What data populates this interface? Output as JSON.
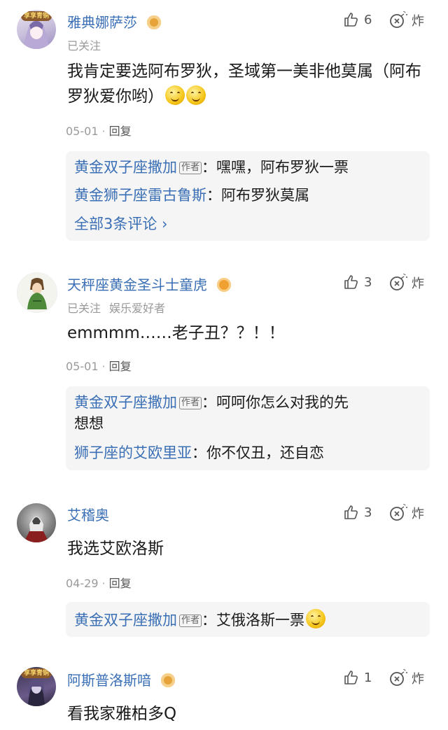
{
  "colors": {
    "link_blue": "#3a6fb5",
    "meta_gray": "#9a9a9a",
    "reply_bg": "#f5f5f5",
    "badge_orange": "#f0a030"
  },
  "icons": {
    "like": "thumbs-up-icon",
    "bomb": "bomb-icon",
    "level": "level-badge-icon",
    "chevron": "chevron-right-icon"
  },
  "comments": [
    {
      "username": "雅典娜萨莎",
      "avatar_badge": "享享青铜",
      "follow_status": "已关注",
      "tag": "",
      "likes": "6",
      "bomb_label": "炸",
      "text": "我肯定要选阿布罗狄，圣域第一美非他莫属（阿布罗狄爱你哟）",
      "date": "05-01",
      "reply_label": "回复",
      "replies": [
        {
          "name": "黄金双子座撒加",
          "author_tag": "作者",
          "text": "：嘿嘿，阿布罗狄一票"
        },
        {
          "name": "黄金狮子座雷古鲁斯",
          "author_tag": "",
          "text": "：阿布罗狄莫属"
        }
      ],
      "expand_label": "全部3条评论 ›"
    },
    {
      "username": "天秤座黄金圣斗士童虎",
      "avatar_badge": "",
      "follow_status": "已关注",
      "tag": "娱乐爱好者",
      "likes": "3",
      "bomb_label": "炸",
      "text": "emmmm……老子丑？？！！",
      "date": "05-01",
      "reply_label": "回复",
      "replies": [
        {
          "name": "黄金双子座撒加",
          "author_tag": "作者",
          "text": "：呵呵你怎么对我的先",
          "text2": "想想"
        },
        {
          "name": "狮子座的艾欧里亚",
          "author_tag": "",
          "text": "：你不仅丑，还自恋"
        }
      ]
    },
    {
      "username": "艾稽奥",
      "likes": "3",
      "bomb_label": "炸",
      "text": "我选艾欧洛斯",
      "date": "04-29",
      "reply_label": "回复",
      "replies": [
        {
          "name": "黄金双子座撒加",
          "author_tag": "作者",
          "text": "：艾俄洛斯一票"
        }
      ]
    },
    {
      "username": "阿斯普洛斯喑",
      "avatar_badge": "享享青铜",
      "likes": "1",
      "bomb_label": "炸",
      "text": "看我家雅柏多Q"
    }
  ]
}
